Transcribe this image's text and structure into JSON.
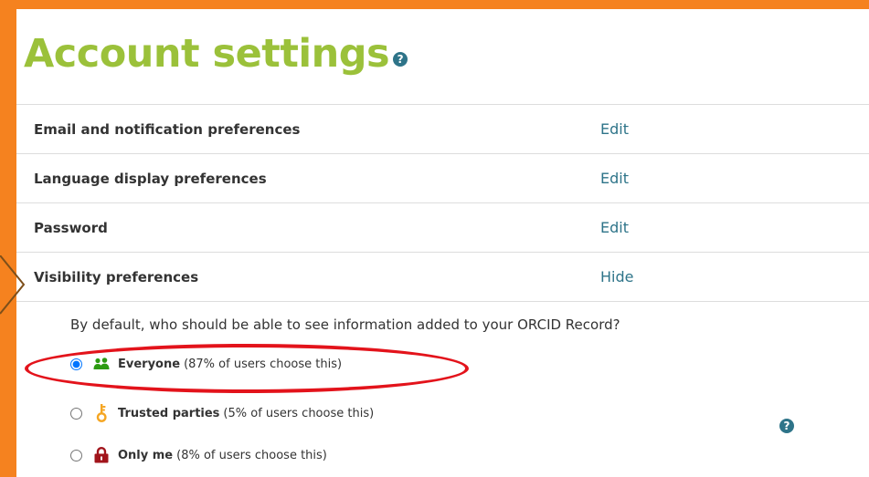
{
  "page": {
    "title": "Account settings",
    "help_glyph": "?"
  },
  "settings": {
    "rows": [
      {
        "label": "Email and notification preferences",
        "action": "Edit"
      },
      {
        "label": "Language display preferences",
        "action": "Edit"
      },
      {
        "label": "Password",
        "action": "Edit"
      },
      {
        "label": "Visibility preferences",
        "action": "Hide"
      }
    ]
  },
  "visibility": {
    "question": "By default, who should be able to see information added to your ORCID Record?",
    "selected": "everyone",
    "options": [
      {
        "label": "Everyone",
        "note": "(87% of users choose this)",
        "icon": "users-icon",
        "icon_color": "#2d9b12"
      },
      {
        "label": "Trusted parties",
        "note": "(5% of users choose this)",
        "icon": "key-icon",
        "icon_color": "#f5a623"
      },
      {
        "label": "Only me",
        "note": "(8% of users choose this)",
        "icon": "lock-icon",
        "icon_color": "#a1141b"
      }
    ],
    "help_glyph": "?"
  },
  "colors": {
    "frame": "#f5821f",
    "title": "#9bc13a",
    "link": "#2e7489",
    "highlight": "#e3131b"
  }
}
